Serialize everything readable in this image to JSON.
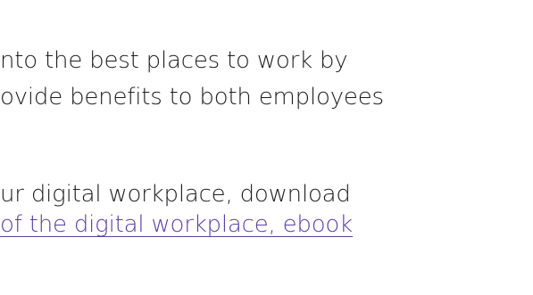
{
  "article": {
    "paragraph_1": {
      "line_1": "nto the best places to work by",
      "line_2": "ovide benefits to both employees"
    },
    "paragraph_2": {
      "line_1": "ur digital workplace, download",
      "link_text": "of the digital workplace, ebook"
    }
  },
  "colors": {
    "text": "#1f1f1f",
    "link": "#5b3fa8",
    "background": "#ffffff"
  }
}
